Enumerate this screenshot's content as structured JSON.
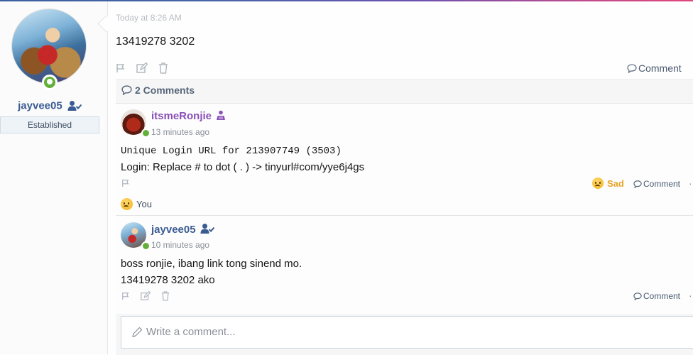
{
  "sidebar": {
    "username": "jayvee05",
    "user_title": "Established"
  },
  "post": {
    "time": "Today at 8:26 AM",
    "body": "13419278 3202",
    "comment_link": "Comment"
  },
  "comments": {
    "count_label": "2 Comments",
    "items": [
      {
        "author": "itsmeRonjie",
        "time": "13 minutes ago",
        "line1": "Unique Login URL for 213907749 (3503)",
        "line2": "Login: Replace # to dot ( . ) -> tinyurl#com/yye6j4gs",
        "reaction_label": "Sad",
        "reacted_by": "You",
        "comment_link": "Comment"
      },
      {
        "author": "jayvee05",
        "time": "10 minutes ago",
        "line1": "boss ronjie, ibang link tong sinend mo.",
        "line2": "13419278 3202 ako",
        "comment_link": "Comment"
      }
    ],
    "reply_placeholder": "Write a comment..."
  },
  "colors": {
    "username_blue": "#3a5c92",
    "ronjie_purple": "#8a4fb8",
    "online_green": "#63b038",
    "sad_orange": "#e6a528"
  }
}
